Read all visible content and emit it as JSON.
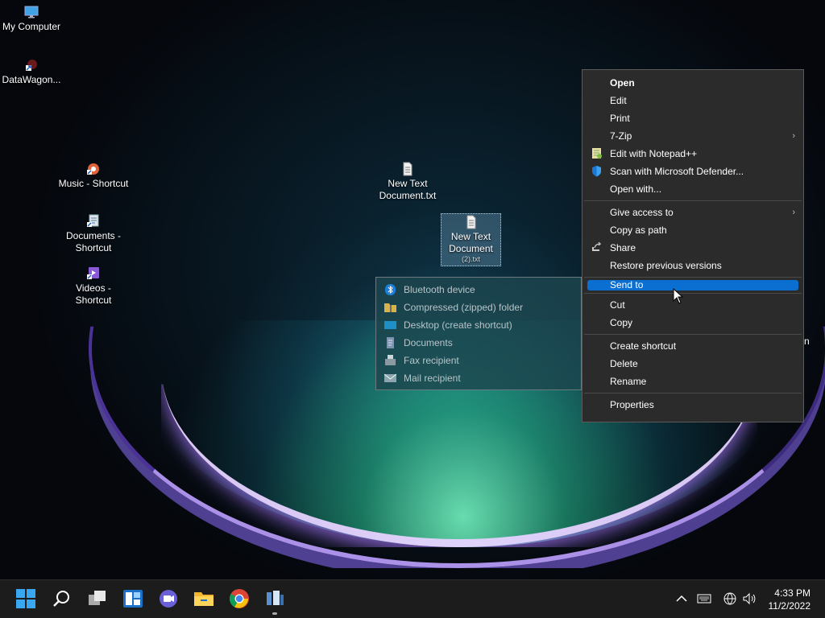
{
  "desktop": {
    "icons": [
      {
        "label": "My Computer",
        "icon": "monitor-icon"
      },
      {
        "label": "DataWagon...",
        "icon": "shortcut-app-icon"
      },
      {
        "label": "Music - Shortcut",
        "icon": "music-icon"
      },
      {
        "label": "Documents - Shortcut",
        "icon": "documents-icon"
      },
      {
        "label": "Videos - Shortcut",
        "icon": "videos-icon"
      },
      {
        "label": "New Text Document.txt",
        "icon": "text-file-icon"
      },
      {
        "label": "New Text Document",
        "sublabel": "(2).txt",
        "icon": "text-file-icon"
      }
    ],
    "partial_label": "n"
  },
  "context_menu": {
    "items": [
      {
        "label": "Open",
        "bold": true
      },
      {
        "label": "Edit"
      },
      {
        "label": "Print"
      },
      {
        "label": "7-Zip",
        "submenu": true
      },
      {
        "label": "Edit with Notepad++",
        "icon": "notepad-plus-icon"
      },
      {
        "label": "Scan with Microsoft Defender...",
        "icon": "defender-shield-icon"
      },
      {
        "label": "Open with..."
      },
      {
        "label": "Give access to",
        "submenu": true
      },
      {
        "label": "Copy as path"
      },
      {
        "label": "Share",
        "icon": "share-icon"
      },
      {
        "label": "Restore previous versions"
      },
      {
        "label": "Send to",
        "highlighted": true
      },
      {
        "label": "Cut"
      },
      {
        "label": "Copy"
      },
      {
        "label": "Create shortcut"
      },
      {
        "label": "Delete"
      },
      {
        "label": "Rename"
      },
      {
        "label": "Properties"
      }
    ]
  },
  "send_to_menu": {
    "items": [
      {
        "label": "Bluetooth device",
        "icon": "bluetooth-icon"
      },
      {
        "label": "Compressed (zipped) folder",
        "icon": "zip-folder-icon"
      },
      {
        "label": "Desktop (create shortcut)",
        "icon": "desktop-icon"
      },
      {
        "label": "Documents",
        "icon": "documents-icon"
      },
      {
        "label": "Fax recipient",
        "icon": "fax-icon"
      },
      {
        "label": "Mail recipient",
        "icon": "mail-icon"
      }
    ]
  },
  "taskbar": {
    "apps": [
      "start-icon",
      "search-icon",
      "task-view-icon",
      "widgets-icon",
      "teams-chat-icon",
      "file-explorer-icon",
      "chrome-icon",
      "app-shortcut-icon"
    ],
    "tray": [
      "chevron-up-icon",
      "keyboard-icon",
      "network-icon",
      "volume-icon"
    ],
    "time": "4:33 PM",
    "date": "11/2/2022"
  },
  "colors": {
    "highlight": "#0a6fd1",
    "menu_bg": "#2b2b2b",
    "taskbar_bg": "#1c1c1c"
  }
}
